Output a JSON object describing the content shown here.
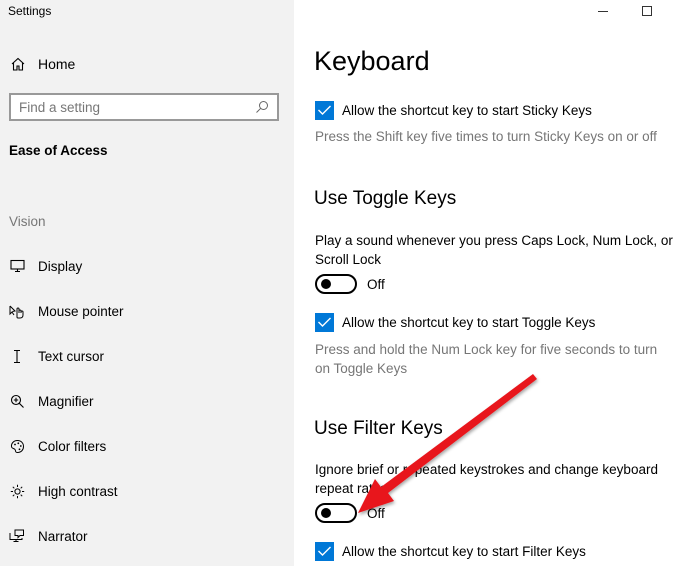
{
  "window": {
    "title": "Settings",
    "minimize_icon": "minimize-icon",
    "maximize_icon": "maximize-icon"
  },
  "sidebar": {
    "home": {
      "label": "Home",
      "icon": "home-icon"
    },
    "search": {
      "placeholder": "Find a setting",
      "value": "",
      "icon": "search-icon"
    },
    "section": "Ease of Access",
    "group_label": "Vision",
    "items": [
      {
        "label": "Display",
        "icon": "monitor-icon"
      },
      {
        "label": "Mouse pointer",
        "icon": "mouse-pointer-icon"
      },
      {
        "label": "Text cursor",
        "icon": "text-cursor-icon"
      },
      {
        "label": "Magnifier",
        "icon": "magnifier-icon"
      },
      {
        "label": "Color filters",
        "icon": "palette-icon"
      },
      {
        "label": "High contrast",
        "icon": "sun-icon"
      },
      {
        "label": "Narrator",
        "icon": "narrator-icon"
      }
    ]
  },
  "main": {
    "title": "Keyboard",
    "sticky_keys": {
      "shortcut_label": "Allow the shortcut key to start Sticky Keys",
      "shortcut_checked": true,
      "shortcut_desc": "Press the Shift key five times to turn Sticky Keys on or off"
    },
    "toggle_keys": {
      "heading": "Use Toggle Keys",
      "description": "Play a sound whenever you press Caps Lock, Num Lock, or Scroll Lock",
      "toggle_state": "Off",
      "shortcut_label": "Allow the shortcut key to start Toggle Keys",
      "shortcut_checked": true,
      "shortcut_desc": "Press and hold the Num Lock key for five seconds to turn on Toggle Keys"
    },
    "filter_keys": {
      "heading": "Use Filter Keys",
      "description": "Ignore brief or repeated keystrokes and change keyboard repeat rates",
      "toggle_state": "Off",
      "shortcut_label": "Allow the shortcut key to start Filter Keys",
      "shortcut_checked": true
    }
  },
  "colors": {
    "accent": "#0078d7",
    "annotation_arrow": "#e8141b",
    "sidebar_bg": "#f2f2f2",
    "secondary_text": "#767676"
  },
  "annotation": {
    "type": "arrow",
    "points_to": "filter-keys-toggle"
  }
}
